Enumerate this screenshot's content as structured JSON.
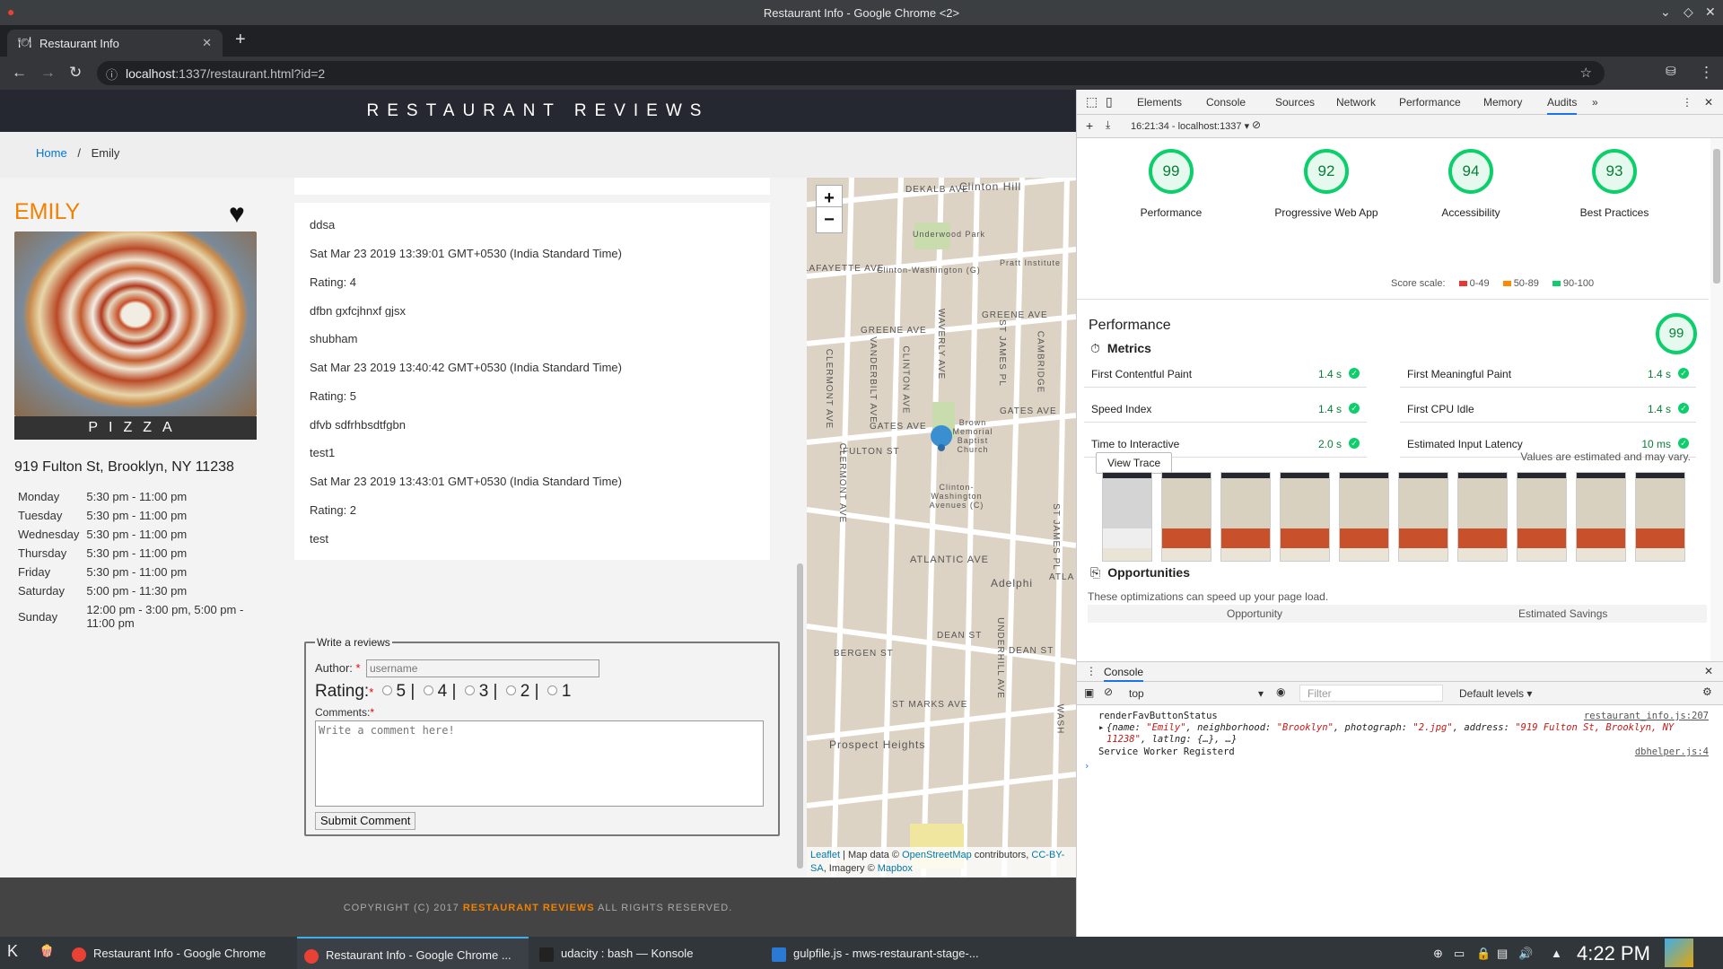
{
  "window": {
    "title": "Restaurant Info - Google Chrome <2>"
  },
  "browser": {
    "tab_title": "Restaurant Info",
    "url_host": "localhost",
    "url_rest": ":1337/restaurant.html?id=2"
  },
  "site": {
    "header": "RESTAURANT REVIEWS",
    "breadcrumb": {
      "home": "Home",
      "separator": "/",
      "current": "Emily"
    },
    "restaurant": {
      "name": "EMILY",
      "cuisine": "PIZZA",
      "address": "919 Fulton St, Brooklyn, NY 11238",
      "hours": [
        {
          "day": "Monday",
          "time": "5:30 pm - 11:00 pm"
        },
        {
          "day": "Tuesday",
          "time": "5:30 pm - 11:00 pm"
        },
        {
          "day": "Wednesday",
          "time": "5:30 pm - 11:00 pm"
        },
        {
          "day": "Thursday",
          "time": "5:30 pm - 11:00 pm"
        },
        {
          "day": "Friday",
          "time": "5:30 pm - 11:00 pm"
        },
        {
          "day": "Saturday",
          "time": "5:00 pm - 11:30 pm"
        },
        {
          "day": "Sunday",
          "time": "12:00 pm - 3:00 pm, 5:00 pm - 11:00 pm"
        }
      ]
    },
    "reviews": [
      {
        "name": "ddsa",
        "date": "Sat Mar 23 2019 13:39:01 GMT+0530 (India Standard Time)",
        "rating": "Rating: 4",
        "comment": "dfbn gxfcjhnxf gjsx"
      },
      {
        "name": "shubham",
        "date": "Sat Mar 23 2019 13:40:42 GMT+0530 (India Standard Time)",
        "rating": "Rating: 5",
        "comment": "dfvb sdfrhbsdtfgbn"
      },
      {
        "name": "test1",
        "date": "Sat Mar 23 2019 13:43:01 GMT+0530 (India Standard Time)",
        "rating": "Rating: 2",
        "comment": "test"
      }
    ],
    "form": {
      "legend": "Write a reviews",
      "author_label": "Author:",
      "author_placeholder": "username",
      "rating_label": "Rating:",
      "rating_options": [
        "5",
        "4",
        "3",
        "2",
        "1"
      ],
      "comments_label": "Comments:",
      "comments_placeholder": "Write a comment here!",
      "submit": "Submit Comment"
    },
    "map": {
      "zoom_in": "+",
      "zoom_out": "−",
      "labels": [
        "DEKALB AVE",
        "Clinton Hill",
        "Underwood Park",
        "Pratt Institute",
        "LAFAYETTE AVE",
        "Clinton-Washington (G)",
        "GREENE AVE",
        "GREENE AVE",
        "CLERMONT AVE",
        "VANDERBILT AVE",
        "CLINTON AVE",
        "WAVERLY AVE",
        "ST JAMES PL",
        "CAMBRIDGE",
        "GATES AVE",
        "GATES AVE",
        "Brown Memorial Baptist Church",
        "FULTON ST",
        "CLERMONT AVE",
        "Clinton-Washington Avenues (C)",
        "ST JAMES PL",
        "ATLANTIC AVE",
        "ATLA",
        "Adelphi",
        "DEAN ST",
        "DEAN ST",
        "UNDERHILL AVE",
        "BERGEN ST",
        "ST MARKS AVE",
        "Prospect Heights",
        "WASH"
      ],
      "attribution": {
        "leaflet": "Leaflet",
        "t1": " | Map data © ",
        "osm": "OpenStreetMap",
        "t2": " contributors, ",
        "cc": "CC-BY-SA",
        "t3": ", Imagery © ",
        "mapbox": "Mapbox"
      }
    },
    "footer": {
      "pre": "COPYRIGHT (C) 2017 ",
      "brand": "RESTAURANT REVIEWS",
      "post": " ALL RIGHTS RESERVED."
    }
  },
  "devtools": {
    "tabs": [
      "Elements",
      "Console",
      "Sources",
      "Network",
      "Performance",
      "Memory",
      "Audits"
    ],
    "active_tab": "Audits",
    "audit_select": "16:21:34 - localhost:1337",
    "gauges": [
      {
        "score": "99",
        "label": "Performance"
      },
      {
        "score": "92",
        "label": "Progressive Web App"
      },
      {
        "score": "94",
        "label": "Accessibility"
      },
      {
        "score": "93",
        "label": "Best Practices"
      }
    ],
    "score_scale": {
      "label": "Score scale:",
      "r1": "0-49",
      "r2": "50-89",
      "r3": "90-100"
    },
    "performance": {
      "title": "Performance",
      "score": "99",
      "metrics_title": "Metrics",
      "metrics": [
        {
          "name": "First Contentful Paint",
          "value": "1.4 s"
        },
        {
          "name": "First Meaningful Paint",
          "value": "1.4 s"
        },
        {
          "name": "Speed Index",
          "value": "1.4 s"
        },
        {
          "name": "First CPU Idle",
          "value": "1.4 s"
        },
        {
          "name": "Time to Interactive",
          "value": "2.0 s"
        },
        {
          "name": "Estimated Input Latency",
          "value": "10 ms"
        }
      ],
      "view_trace": "View Trace",
      "estimate_note": "Values are estimated and may vary.",
      "opportunities_title": "Opportunities",
      "opportunities_desc": "These optimizations can speed up your page load.",
      "col_opportunity": "Opportunity",
      "col_savings": "Estimated Savings"
    },
    "console": {
      "tab": "Console",
      "context": "top",
      "filter_placeholder": "Filter",
      "levels": "Default levels",
      "lines": [
        {
          "text": "renderFavButtonStatus",
          "source": "restaurant_info.js:207"
        },
        {
          "text": "Service Worker Registerd",
          "source": "dbhelper.js:4"
        }
      ],
      "object": {
        "k1": "{name: ",
        "v1": "\"Emily\"",
        "k2": ", neighborhood: ",
        "v2": "\"Brooklyn\"",
        "k3": ", photograph: ",
        "v3": "\"2.jpg\"",
        "k4": ", address: ",
        "v4": "\"919 Fulton St, Brooklyn, NY 11238\"",
        "k5": ", latlng: {…}, …}"
      }
    }
  },
  "taskbar": {
    "items": [
      {
        "label": "Restaurant Info - Google Chrome"
      },
      {
        "label": "Restaurant Info - Google Chrome ..."
      },
      {
        "label": "udacity : bash — Konsole"
      },
      {
        "label": "gulpfile.js - mws-restaurant-stage-..."
      }
    ],
    "clock": "4:22 PM"
  },
  "colors": {
    "accent": "#f18200",
    "header_bg": "#252831",
    "pass_green": "#0cce6b",
    "link": "#0275d8"
  }
}
